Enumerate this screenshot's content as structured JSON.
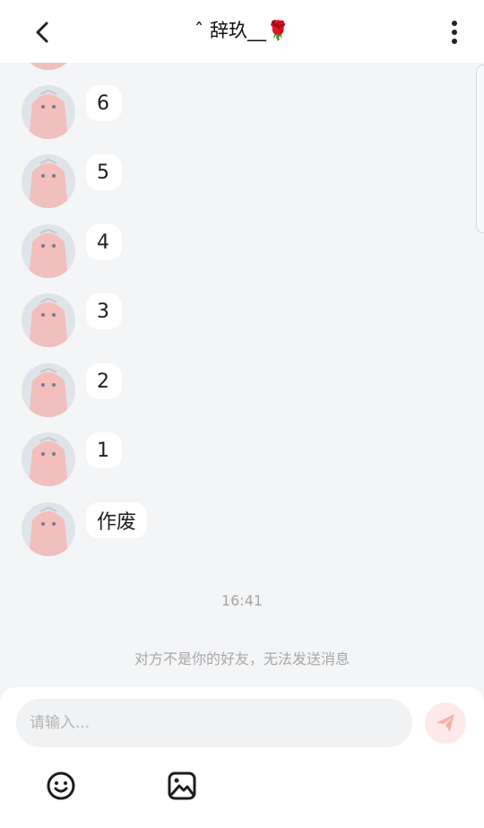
{
  "header": {
    "title": "ˆ 辞玖__🌹",
    "back_icon": "chevron-left-icon",
    "more_icon": "more-vertical-icon"
  },
  "messages": [
    {
      "text": "6"
    },
    {
      "text": "5"
    },
    {
      "text": "4"
    },
    {
      "text": "3"
    },
    {
      "text": "2"
    },
    {
      "text": "1"
    },
    {
      "text": "作废"
    }
  ],
  "timestamp": "16:41",
  "notice": "对方不是你的好友，无法发送消息",
  "composer": {
    "placeholder": "请输入...",
    "send_icon": "send-icon",
    "emoji_icon": "emoji-icon",
    "image_icon": "image-icon"
  },
  "colors": {
    "background": "#f4f5f7",
    "header": "#ffffff",
    "bubble": "#ffffff",
    "send_disabled": "#fdeae8",
    "send_icon": "#f7b1a9"
  }
}
